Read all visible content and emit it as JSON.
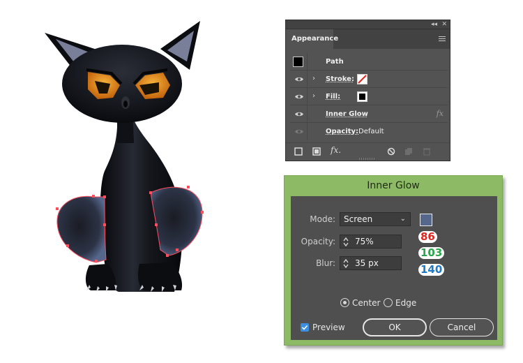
{
  "appearance_panel": {
    "tab_label": "Appearance",
    "collapse_glyph": "◂◂",
    "close_glyph": "✕",
    "rows": [
      {
        "label": "Path"
      },
      {
        "label": "Stroke:"
      },
      {
        "label": "Fill:"
      },
      {
        "label": "Inner Glow",
        "fx": "fx"
      },
      {
        "label": "Opacity:",
        "value": "Default"
      }
    ],
    "bottom_fx": "fx."
  },
  "inner_glow": {
    "title": "Inner Glow",
    "mode_label": "Mode:",
    "mode_value": "Screen",
    "opacity_label": "Opacity:",
    "opacity_value": "75%",
    "blur_label": "Blur:",
    "blur_value": "35 px",
    "color": "#56678c",
    "rgb": {
      "r": "86",
      "g": "103",
      "b": "140"
    },
    "radio_center": "Center",
    "radio_edge": "Edge",
    "preview_label": "Preview",
    "ok_label": "OK",
    "cancel_label": "Cancel"
  },
  "colors": {
    "dialog_green": "#8dbb65",
    "panel_gray": "#535353",
    "cat_body": "#0e0f14",
    "eye_orange": "#e8901c",
    "selection_red": "#ff4d5e",
    "rgb_red": "#e0261f",
    "rgb_green": "#2aa64a",
    "rgb_blue": "#1f78c8"
  }
}
